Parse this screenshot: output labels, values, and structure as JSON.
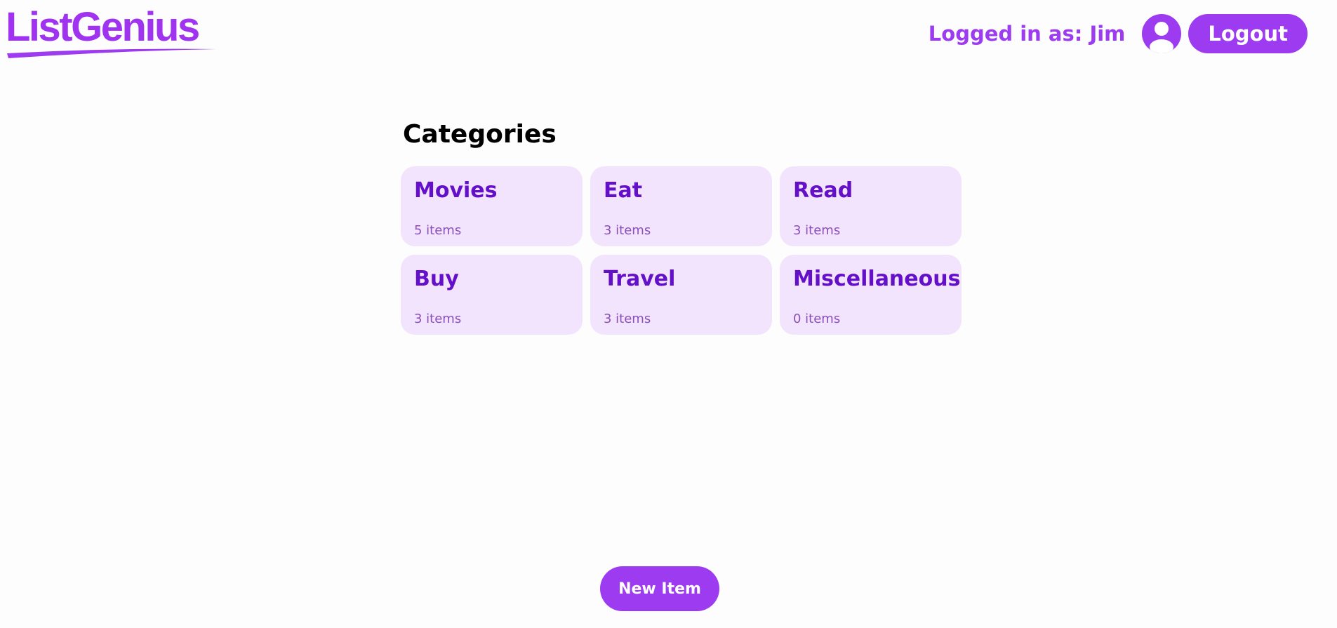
{
  "header": {
    "logo_text": "ListGenius",
    "user_label": "Logged in as: Jim",
    "avatar_icon": "user-avatar-icon",
    "logout_label": "Logout"
  },
  "main": {
    "title": "Categories",
    "categories": [
      {
        "name": "Movies",
        "count": "5 items"
      },
      {
        "name": "Eat",
        "count": "3 items"
      },
      {
        "name": "Read",
        "count": "3 items"
      },
      {
        "name": "Buy",
        "count": "3 items"
      },
      {
        "name": "Travel",
        "count": "3 items"
      },
      {
        "name": "Miscellaneous",
        "count": "0 items"
      }
    ]
  },
  "footer": {
    "new_item_label": "New Item"
  },
  "colors": {
    "brand": "#9d3bf0",
    "card_background": "#f3e4fd",
    "card_title": "#6410c8",
    "card_count": "#8b4fb8",
    "page_background": "#fdfdfd"
  }
}
